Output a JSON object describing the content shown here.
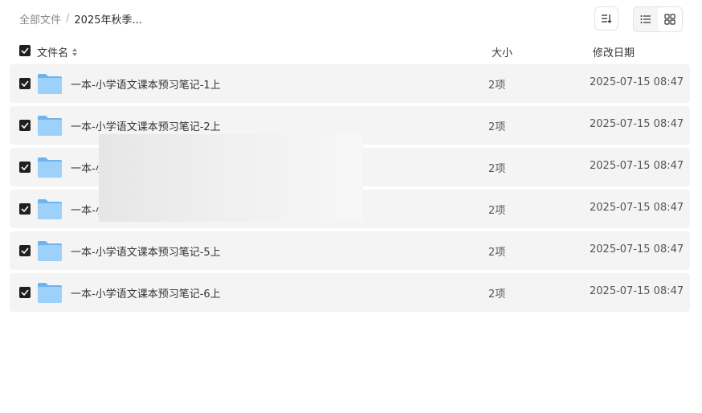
{
  "breadcrumb": {
    "root": "全部文件",
    "separator": "/",
    "current": "2025年秋季..."
  },
  "toolbar": {
    "sort_icon": "sort-icon",
    "list_view_icon": "list-view-icon",
    "grid_view_icon": "grid-view-icon"
  },
  "table": {
    "headers": {
      "name": "文件名",
      "size": "大小",
      "date": "修改日期"
    },
    "rows": [
      {
        "name": "一本-小学语文课本预习笔记-1上",
        "size": "2项",
        "date": "2025-07-15 08:47"
      },
      {
        "name": "一本-小学语文课本预习笔记-2上",
        "size": "2项",
        "date": "2025-07-15 08:47"
      },
      {
        "name": "一本-小",
        "size": "2项",
        "date": "2025-07-15 08:47"
      },
      {
        "name": "一本-小",
        "size": "2项",
        "date": "2025-07-15 08:47"
      },
      {
        "name": "一本-小学语文课本预习笔记-5上",
        "size": "2项",
        "date": "2025-07-15 08:47"
      },
      {
        "name": "一本-小学语文课本预习笔记-6上",
        "size": "2项",
        "date": "2025-07-15 08:47"
      }
    ]
  },
  "colors": {
    "row_background": "#f4f4f4",
    "checkbox": "#1f1f1f",
    "folder_blue": "#8cc8f5"
  }
}
